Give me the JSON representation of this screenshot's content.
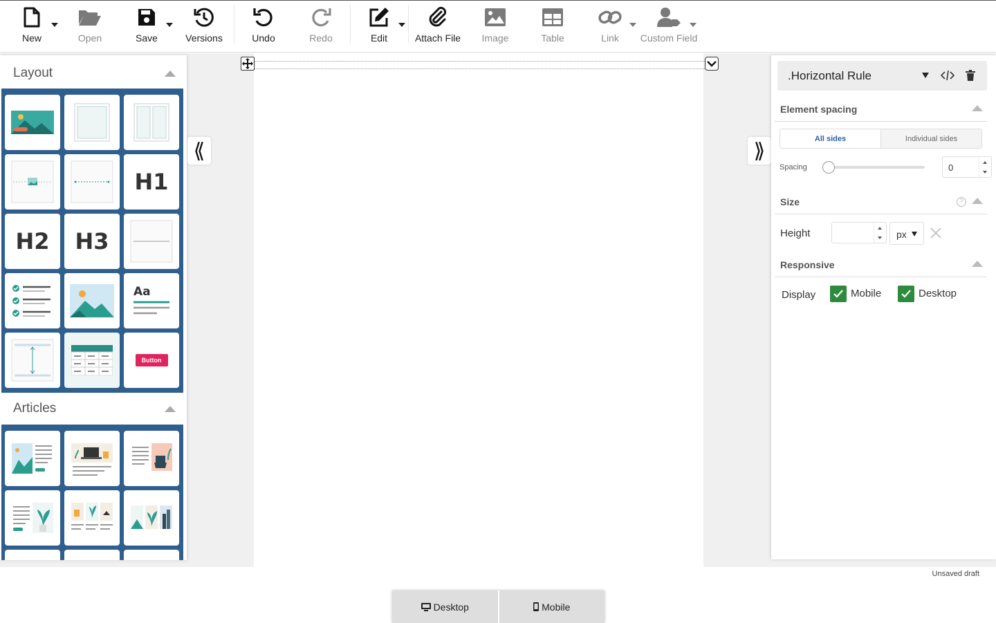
{
  "toolbar": {
    "new": "New",
    "open": "Open",
    "save": "Save",
    "versions": "Versions",
    "undo": "Undo",
    "redo": "Redo",
    "edit": "Edit",
    "attach": "Attach File",
    "image": "Image",
    "table": "Table",
    "link": "Link",
    "custom_field": "Custom Field"
  },
  "left_panel": {
    "layout_title": "Layout",
    "articles_title": "Articles",
    "tiles": {
      "h1": "H1",
      "h2": "H2",
      "h3": "H3",
      "aa": "Aa",
      "button": "Button"
    }
  },
  "right_panel": {
    "element_name": ".Horizontal Rule",
    "element_spacing": "Element spacing",
    "all_sides": "All sides",
    "individual_sides": "Individual sides",
    "spacing_label": "Spacing",
    "spacing_value": "0",
    "spacing_level": 0,
    "size": "Size",
    "height_label": "Height",
    "height_value": "",
    "unit": "px",
    "responsive": "Responsive",
    "display_label": "Display",
    "mobile": "Mobile",
    "desktop": "Desktop",
    "mobile_checked": true,
    "desktop_checked": true
  },
  "status": "Unsaved draft",
  "view": {
    "desktop": "Desktop",
    "mobile": "Mobile"
  },
  "colors": {
    "panel_blue": "#2f5f8f",
    "teal": "#2a9d8f",
    "check_green": "#2e8b3e",
    "accent_pink": "#e0245e"
  }
}
